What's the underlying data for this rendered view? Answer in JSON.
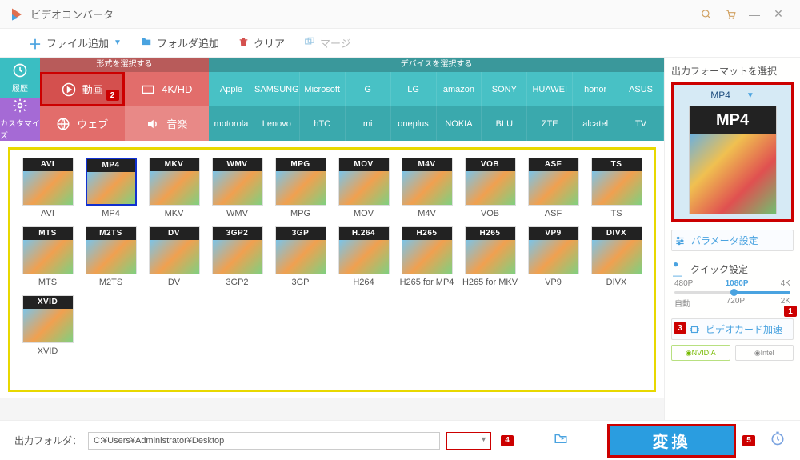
{
  "titlebar": {
    "title": "ビデオコンバータ"
  },
  "toolbar": {
    "add_file": "ファイル追加",
    "add_folder": "フォルダ追加",
    "clear": "クリア",
    "merge": "マージ"
  },
  "left_tabs": {
    "history": "履歴",
    "customize": "カスタマイズ"
  },
  "cat_headers": {
    "format": "形式を選択する",
    "device": "デバイスを選択する"
  },
  "categories": {
    "video": "動画",
    "hd": "4K/HD",
    "web": "ウェブ",
    "audio": "音楽"
  },
  "brands_top": [
    "Apple",
    "SAMSUNG",
    "Microsoft",
    "G",
    "LG",
    "amazon",
    "SONY",
    "HUAWEI",
    "honor",
    "ASUS"
  ],
  "brands_bot": [
    "motorola",
    "Lenovo",
    "hTC",
    "mi",
    "oneplus",
    "NOKIA",
    "BLU",
    "ZTE",
    "alcatel",
    "TV"
  ],
  "formats_row1": [
    "AVI",
    "MP4",
    "MKV",
    "WMV",
    "MPG",
    "MOV",
    "M4V",
    "VOB",
    "ASF",
    "TS"
  ],
  "formats_row2": [
    "MTS",
    "M2TS",
    "DV",
    "3GP2",
    "3GP",
    "H264",
    "H265 for MP4",
    "H265 for MKV",
    "VP9",
    "DIVX"
  ],
  "format_badges_row1": [
    "AVI",
    "MP4",
    "MKV",
    "WMV",
    "MPG",
    "MOV",
    "M4V",
    "VOB",
    "ASF",
    "TS"
  ],
  "format_badges_row2": [
    "MTS",
    "M2TS",
    "DV",
    "3GP2",
    "3GP",
    "H.264",
    "H265",
    "H265",
    "VP9",
    "DIVX"
  ],
  "formats_row3_labels": [
    "XVID"
  ],
  "format_badges_row3": [
    "XVID"
  ],
  "selected_format": "MP4",
  "right": {
    "title": "出力フォーマットを選択",
    "selected": "MP4",
    "big_badge": "MP4",
    "param": "パラメータ設定",
    "quick": "クイック設定",
    "gpu": "ビデオカード加速",
    "nvidia": "NVIDIA",
    "intel": "Intel",
    "qualities": [
      "480P",
      "1080P",
      "4K"
    ],
    "qualities2": [
      "自動",
      "720P",
      "2K"
    ]
  },
  "bottom": {
    "label": "出力フォルダ：",
    "path": "C:¥Users¥Administrator¥Desktop",
    "convert": "変換"
  },
  "badges": {
    "b1": "1",
    "b2": "2",
    "b3": "3",
    "b4": "4",
    "b5": "5"
  }
}
